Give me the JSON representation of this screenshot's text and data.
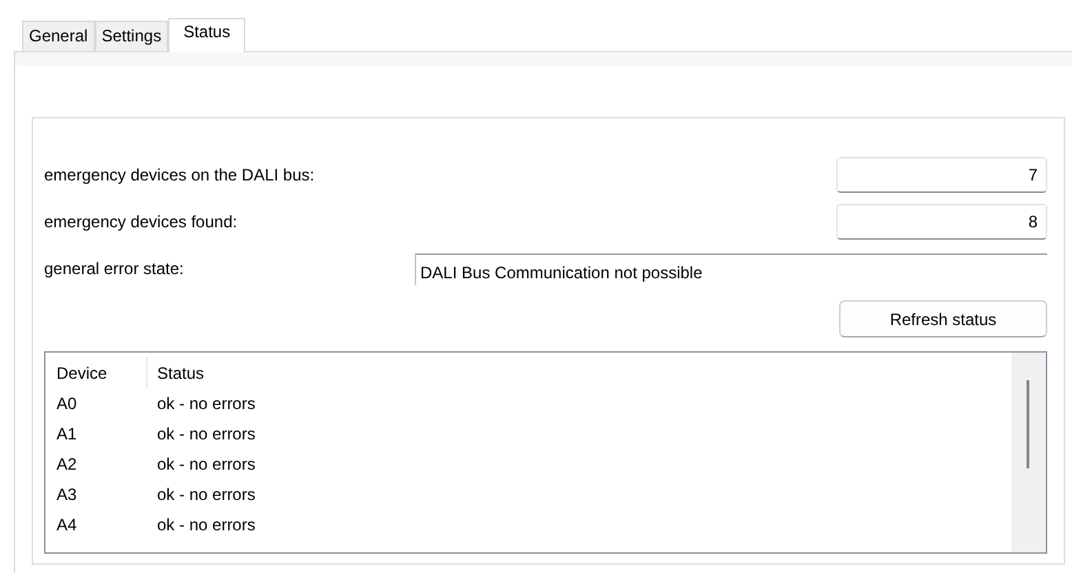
{
  "tabs": [
    {
      "label": "General",
      "selected": false
    },
    {
      "label": "Settings",
      "selected": false
    },
    {
      "label": "Status",
      "selected": true
    }
  ],
  "fields": [
    {
      "label": "emergency devices on the DALI bus:",
      "value": "7",
      "kind": "number"
    },
    {
      "label": "emergency devices found:",
      "value": "8",
      "kind": "number"
    },
    {
      "label": "general error state:",
      "value": "DALI Bus Communication not possible",
      "kind": "text"
    }
  ],
  "refresh_button": "Refresh status",
  "table": {
    "columns": [
      "Device",
      "Status"
    ],
    "rows": [
      [
        "A0",
        "ok - no errors"
      ],
      [
        "A1",
        "ok - no errors"
      ],
      [
        "A2",
        "ok - no errors"
      ],
      [
        "A3",
        "ok - no errors"
      ],
      [
        "A4",
        "ok - no errors"
      ]
    ]
  }
}
